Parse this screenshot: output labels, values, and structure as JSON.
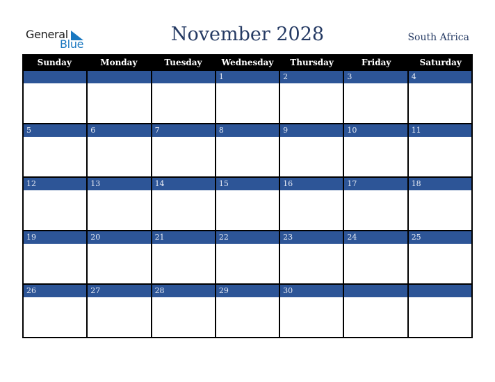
{
  "logo": {
    "line1": "General",
    "line2": "Blue",
    "color": "#1b78c0"
  },
  "title": "November 2028",
  "country": "South Africa",
  "colors": {
    "header_bg": "#000000",
    "band_bg": "#2d5597",
    "title": "#253a63"
  },
  "weekdays": [
    "Sunday",
    "Monday",
    "Tuesday",
    "Wednesday",
    "Thursday",
    "Friday",
    "Saturday"
  ],
  "weeks": [
    [
      "",
      "",
      "",
      "1",
      "2",
      "3",
      "4"
    ],
    [
      "5",
      "6",
      "7",
      "8",
      "9",
      "10",
      "11"
    ],
    [
      "12",
      "13",
      "14",
      "15",
      "16",
      "17",
      "18"
    ],
    [
      "19",
      "20",
      "21",
      "22",
      "23",
      "24",
      "25"
    ],
    [
      "26",
      "27",
      "28",
      "29",
      "30",
      "",
      ""
    ]
  ]
}
